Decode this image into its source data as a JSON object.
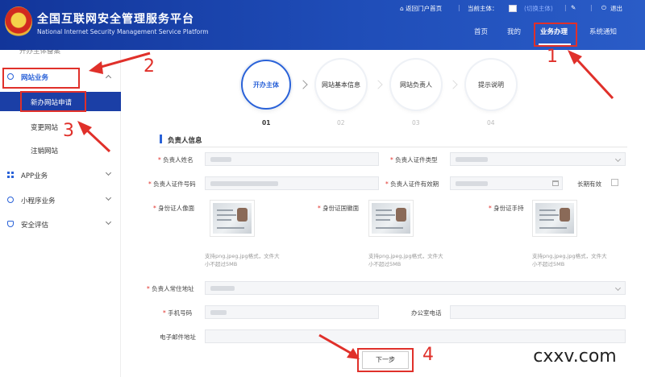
{
  "header": {
    "title_cn": "全国互联网安全管理服务平台",
    "title_en": "National Internet Security Management Service Platform",
    "top_links": {
      "home_portal": "⌂ 返回门户首页",
      "current_subject": "当前主体：",
      "switch_subject": "(切换主体)",
      "logout": "退出"
    },
    "nav": [
      "首页",
      "我的",
      "业务办理",
      "系统通知"
    ],
    "active_nav": "业务办理"
  },
  "sidebar": {
    "top_cut": "开办主体备案",
    "website_business": "网站业务",
    "sub_items": [
      "新办网站申请",
      "变更网站",
      "注销网站"
    ],
    "active_sub": "新办网站申请",
    "app_business": "APP业务",
    "mini_program": "小程序业务",
    "security_eval": "安全评估"
  },
  "steps": [
    {
      "label": "开办主体",
      "num": "01",
      "active": true
    },
    {
      "label": "网站基本信息",
      "num": "02",
      "active": false
    },
    {
      "label": "网站负责人",
      "num": "03",
      "active": false
    },
    {
      "label": "提示说明",
      "num": "04",
      "active": false
    }
  ],
  "section": {
    "title": "负责人信息"
  },
  "form": {
    "name_label": "负责人姓名",
    "id_type_label": "负责人证件类型",
    "id_no_label": "负责人证件号码",
    "id_valid_label": "负责人证件有效期",
    "long_term_label": "长期有效",
    "id_front_label": "身份证人像面",
    "id_back_label": "身份证国徽面",
    "id_hand_label": "身份证手持",
    "upload_hint_1": "支持png,jpeg,jpg格式，文件大",
    "upload_hint_2": "小不超过5MB",
    "address_label": "负责人常住地址",
    "phone_label": "手机号码",
    "office_phone_label": "办公室电话",
    "email_label": "电子邮件地址"
  },
  "buttons": {
    "next": "下一步"
  },
  "annotations": [
    "1",
    "2",
    "3",
    "4"
  ],
  "watermark": "cxxv.com",
  "colors": {
    "header_blue": "#1b3fa6",
    "annotation_red": "#e0302a",
    "active_step_blue": "#2a62d8"
  }
}
